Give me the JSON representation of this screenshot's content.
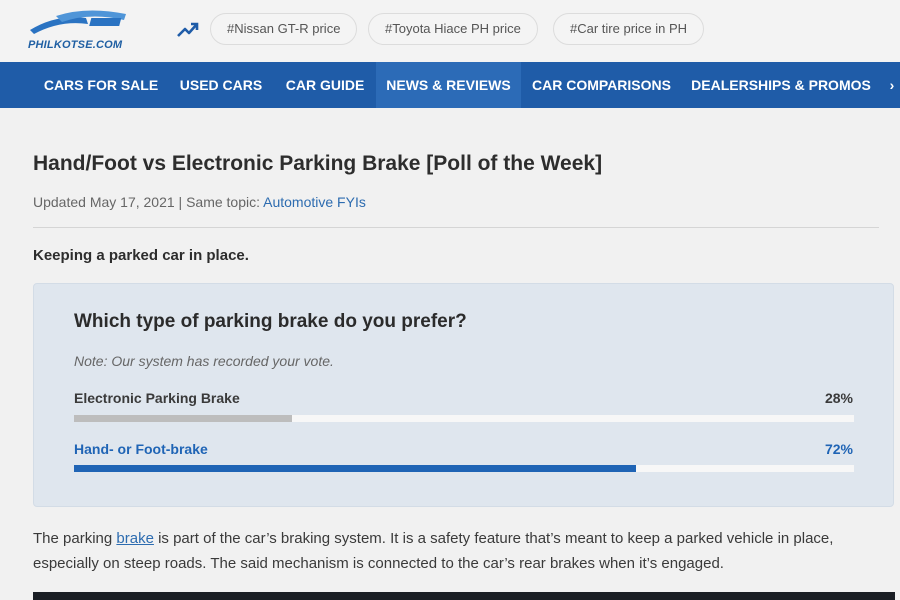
{
  "header": {
    "logo_text": "PHILKOTSE.COM",
    "trending_chips": [
      "#Nissan GT-R price",
      "#Toyota Hiace PH price",
      "#Car tire price in PH"
    ]
  },
  "nav": {
    "items": [
      {
        "label": "CARS FOR SALE"
      },
      {
        "label": "USED CARS"
      },
      {
        "label": "CAR GUIDE"
      },
      {
        "label": "NEWS & REVIEWS",
        "active": true
      },
      {
        "label": "CAR COMPARISONS"
      },
      {
        "label": "DEALERSHIPS & PROMOS"
      }
    ]
  },
  "article": {
    "title": "Hand/Foot vs Electronic Parking Brake [Poll of the Week]",
    "meta_prefix": "Updated May 17, 2021 | Same topic: ",
    "meta_topic_link": "Automotive FYIs",
    "lead": "Keeping a parked car in place.",
    "body_before_link": "The parking ",
    "body_link": "brake",
    "body_after_link": " is part of the car’s braking system. It is a safety feature that’s meant to keep a parked vehicle in place, especially on steep roads. The said mechanism is connected to the car’s rear brakes when it’s engaged."
  },
  "poll": {
    "question": "Which type of parking brake do you prefer?",
    "note": "Note: Our system has recorded your vote.",
    "options": [
      {
        "label": "Electronic Parking Brake",
        "percent_label": "28%",
        "fraction": 0.28,
        "color": "#bdbdbd",
        "text_color": "#3a3a3a"
      },
      {
        "label": "Hand- or Foot-brake",
        "percent_label": "72%",
        "fraction": 0.72,
        "color": "#1f64b5",
        "text_color": "#1f64b5"
      }
    ]
  },
  "colors": {
    "nav_bg": "#1f5ca8",
    "link": "#2d6cb0",
    "accent": "#1f64b5"
  }
}
